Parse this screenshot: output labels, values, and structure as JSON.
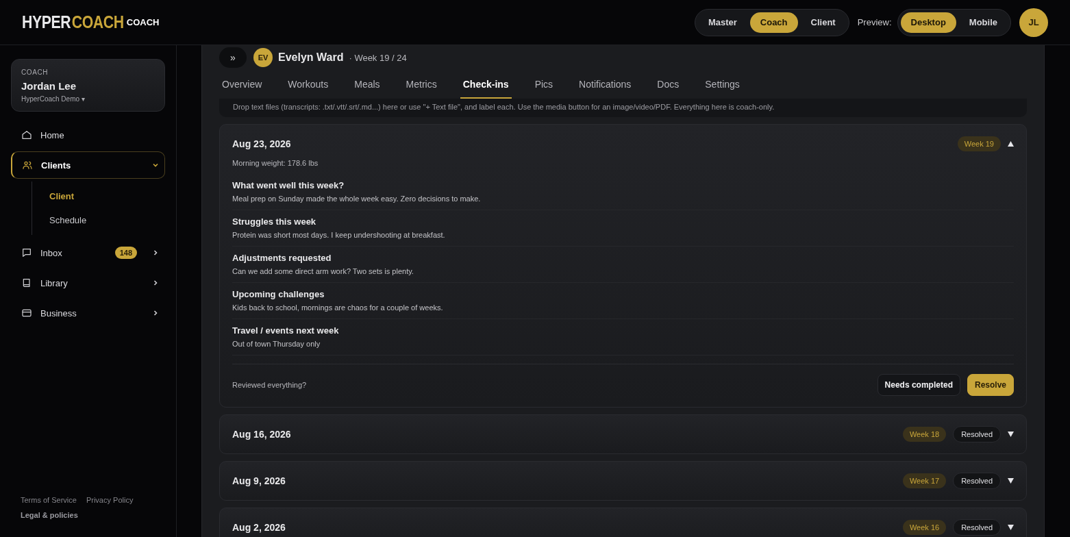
{
  "logo": {
    "primary": "HYPER",
    "accent": "COACH",
    "role": "COACH"
  },
  "roles": [
    {
      "label": "Master",
      "selected": false
    },
    {
      "label": "Coach",
      "selected": true
    },
    {
      "label": "Client",
      "selected": false
    }
  ],
  "preview": {
    "label": "Preview:",
    "options": [
      {
        "label": "Desktop",
        "selected": true
      },
      {
        "label": "Mobile",
        "selected": false
      }
    ]
  },
  "user_avatar": "JL",
  "coach_card": {
    "caption": "COACH",
    "name": "Jordan Lee",
    "org": "HyperCoach Demo ▾"
  },
  "sidebar": {
    "items": [
      {
        "label": "Home",
        "selected": false
      },
      {
        "label": "Clients",
        "selected": true,
        "expanded": true,
        "children": [
          {
            "label": "Client",
            "selected": true
          },
          {
            "label": "Schedule",
            "selected": false
          }
        ]
      },
      {
        "label": "Inbox",
        "selected": false,
        "expanded": false,
        "badge": "148"
      },
      {
        "label": "Library",
        "selected": false,
        "expanded": false
      },
      {
        "label": "Business",
        "selected": false,
        "expanded": false
      }
    ]
  },
  "footer_links": [
    "Terms of Service",
    "Privacy Policy",
    "Legal & policies"
  ],
  "client": {
    "expand_icon": "»",
    "initials": "EV",
    "name": "Evelyn Ward",
    "week": "· Week 19 / 24"
  },
  "tabs": [
    {
      "label": "Overview",
      "selected": false
    },
    {
      "label": "Workouts",
      "selected": false
    },
    {
      "label": "Meals",
      "selected": false
    },
    {
      "label": "Metrics",
      "selected": false
    },
    {
      "label": "Check-ins",
      "selected": true
    },
    {
      "label": "Pics",
      "selected": false
    },
    {
      "label": "Notifications",
      "selected": false
    },
    {
      "label": "Docs",
      "selected": false
    },
    {
      "label": "Settings",
      "selected": false
    }
  ],
  "drop_hint": "Drop text files (transcripts: .txt/.vtt/.srt/.md...) here or use \"+ Text file\", and label each. Use the media button for an image/video/PDF. Everything here is coach-only.",
  "checkins": [
    {
      "date": "Aug 23, 2026",
      "week": "Week 19",
      "expanded": true,
      "weight": "Morning weight: 178.6 lbs",
      "answers": [
        {
          "question": "What went well this week?",
          "answer": "Meal prep on Sunday made the whole week easy. Zero decisions to make."
        },
        {
          "question": "Struggles this week",
          "answer": "Protein was short most days. I keep undershooting at breakfast."
        },
        {
          "question": "Adjustments requested",
          "answer": "Can we add some direct arm work? Two sets is plenty."
        },
        {
          "question": "Upcoming challenges",
          "answer": "Kids back to school, mornings are chaos for a couple of weeks."
        },
        {
          "question": "Travel / events next week",
          "answer": "Out of town Thursday only"
        }
      ],
      "review_prompt": "Reviewed everything?",
      "actions": [
        "Needs completed",
        "Resolve"
      ]
    },
    {
      "date": "Aug 16, 2026",
      "week": "Week 18",
      "status": "Resolved",
      "expanded": false
    },
    {
      "date": "Aug 9, 2026",
      "week": "Week 17",
      "status": "Resolved",
      "expanded": false
    },
    {
      "date": "Aug 2, 2026",
      "week": "Week 16",
      "status": "Resolved",
      "expanded": false
    }
  ]
}
